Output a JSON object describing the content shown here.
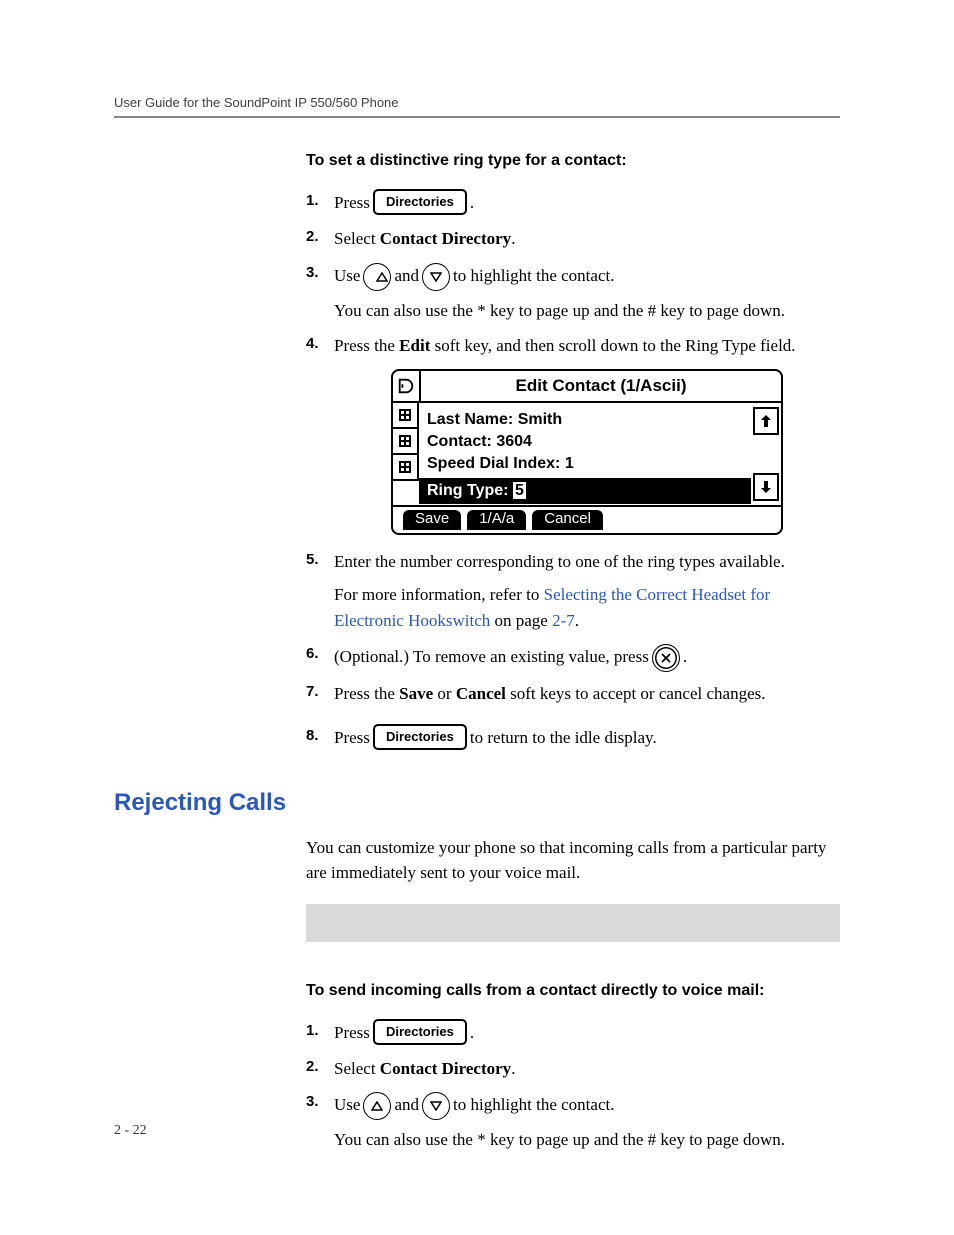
{
  "header": {
    "running": "User Guide for the SoundPoint IP 550/560 Phone"
  },
  "proc1": {
    "title": "To set a distinctive ring type for a contact:",
    "steps": {
      "s1_a": "Press ",
      "s1_key": "Directories",
      "s1_b": " .",
      "s2_a": "Select ",
      "s2_bold": "Contact Directory",
      "s2_b": ".",
      "s3_a": "Use ",
      "s3_b": " and ",
      "s3_c": " to highlight the contact.",
      "s3_sub": "You can also use the * key to page up and the # key to page down.",
      "s4_a": "Press the ",
      "s4_bold": "Edit",
      "s4_b": " soft key, and then scroll down to the Ring Type field.",
      "s5_a": "Enter the number corresponding to one of the ring types available.",
      "s5_sub_a": "For more information, refer to ",
      "s5_link": "Selecting the Correct Headset for Electronic Hookswitch",
      "s5_sub_b": " on page ",
      "s5_pageref": "2-7",
      "s5_sub_c": ".",
      "s6_a": "(Optional.) To remove an existing value, press ",
      "s6_b": ".",
      "s7_a": "Press the ",
      "s7_bold1": "Save",
      "s7_b": " or ",
      "s7_bold2": "Cancel",
      "s7_c": " soft keys to accept or cancel changes.",
      "s8_a": "Press ",
      "s8_key": "Directories",
      "s8_b": " to return to the idle display."
    }
  },
  "lcd": {
    "title": "Edit Contact (1/Ascii)",
    "fields": {
      "last_name_label": "Last Name:",
      "last_name_value": "Smith",
      "contact_label": "Contact:",
      "contact_value": "3604",
      "speed_label": "Speed Dial Index:",
      "speed_value": "1",
      "ring_label": "Ring Type:",
      "ring_value": "5"
    },
    "softkeys": [
      "Save",
      "1/A/a",
      "Cancel"
    ]
  },
  "section2": {
    "title": "Rejecting Calls",
    "intro": "You can customize your phone so that incoming calls from a particular party are immediately sent to your voice mail."
  },
  "proc2": {
    "title": "To send incoming calls from a contact directly to voice mail:",
    "steps": {
      "s1_a": "Press ",
      "s1_key": "Directories",
      "s1_b": " .",
      "s2_a": "Select ",
      "s2_bold": "Contact Directory",
      "s2_b": ".",
      "s3_a": "Use ",
      "s3_b": " and ",
      "s3_c": " to highlight the contact.",
      "s3_sub": "You can also use the * key to page up and the # key to page down."
    }
  },
  "footer": {
    "page": "2 - 22"
  }
}
